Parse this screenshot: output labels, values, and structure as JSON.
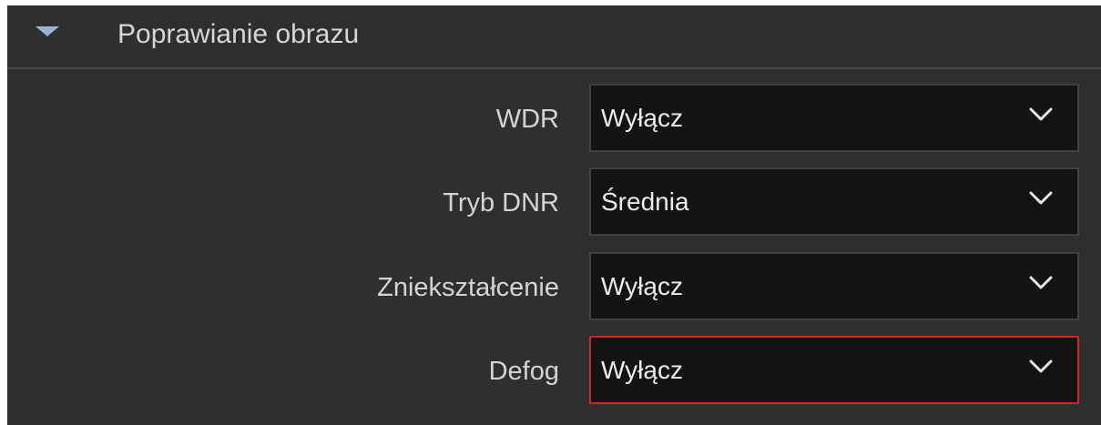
{
  "section": {
    "title": "Poprawianie obrazu",
    "collapse_icon": "caret-down-icon"
  },
  "fields": [
    {
      "label": "WDR",
      "value": "Wyłącz",
      "focused": false
    },
    {
      "label": "Tryb DNR",
      "value": "Średnia",
      "focused": false
    },
    {
      "label": "Zniekształcenie",
      "value": "Wyłącz",
      "focused": false
    },
    {
      "label": "Defog",
      "value": "Wyłącz",
      "focused": true
    }
  ],
  "dropdown_icon": "chevron-down-icon",
  "colors": {
    "panel_background": "#2f2f2f",
    "select_background": "#141414",
    "focus_border": "#cc2a2a",
    "caret": "#9bb3cf"
  }
}
